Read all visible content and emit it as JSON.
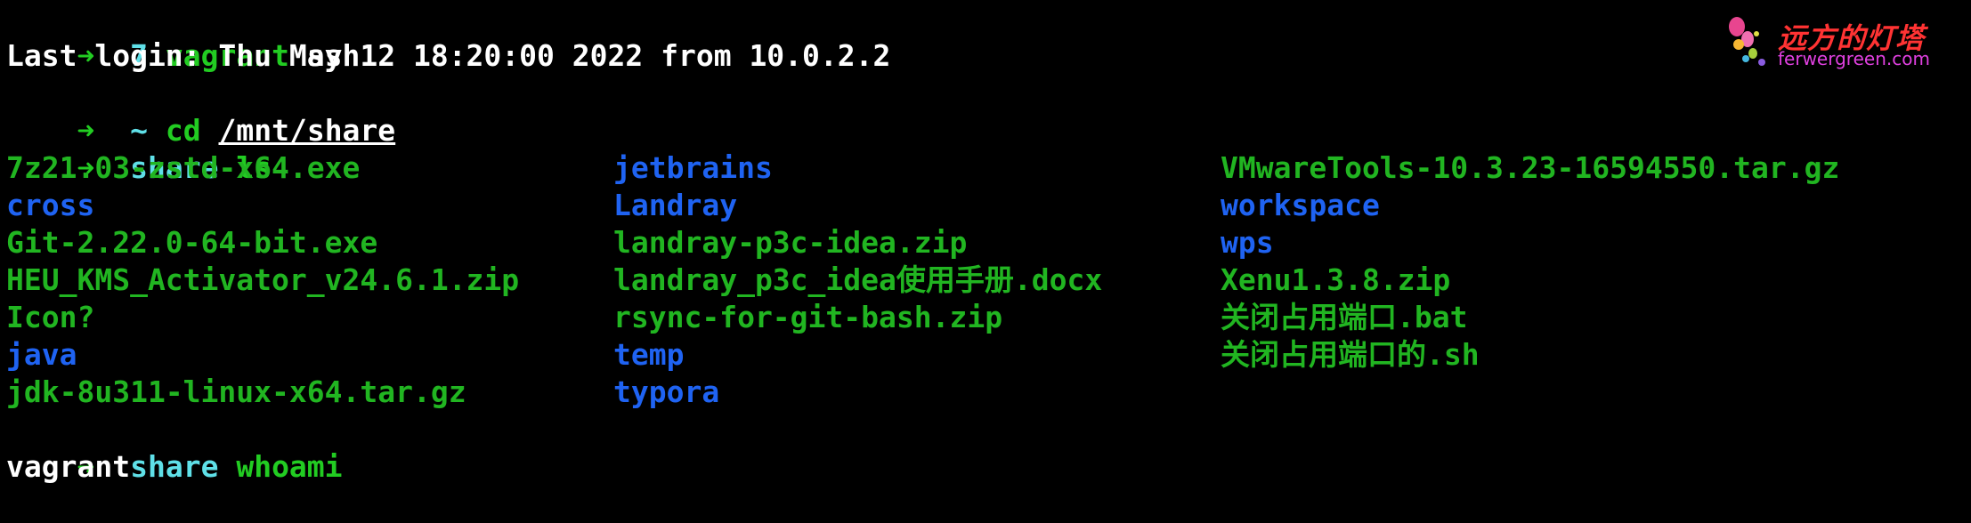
{
  "colors": {
    "background": "#000000",
    "prompt_arrow": "#22cc22",
    "prompt_dir": "#5fe0e8",
    "file": "#21b521",
    "directory": "#1f63f2",
    "output": "#ffffff"
  },
  "terminal": {
    "line1": {
      "arrow": "➜",
      "dir": "7",
      "command": "vagrant",
      "arg": "ssh"
    },
    "login_line": "Last login: Thu May 12 18:20:00 2022 from 10.0.2.2",
    "line3": {
      "arrow": "➜",
      "dir": "~",
      "command": "cd",
      "arg": "/mnt/share"
    },
    "line4": {
      "arrow": "➜",
      "dir": "share",
      "command": "ls"
    },
    "listing": {
      "col1": [
        {
          "name": "7z21.03-zstd-x64.exe",
          "type": "file"
        },
        {
          "name": "cross",
          "type": "dir"
        },
        {
          "name": "Git-2.22.0-64-bit.exe",
          "type": "file"
        },
        {
          "name": "HEU_KMS_Activator_v24.6.1.zip",
          "type": "file"
        },
        {
          "name": "Icon?",
          "type": "file"
        },
        {
          "name": "java",
          "type": "dir"
        },
        {
          "name": "jdk-8u311-linux-x64.tar.gz",
          "type": "file"
        }
      ],
      "col2": [
        {
          "name": "jetbrains",
          "type": "dir"
        },
        {
          "name": "Landray",
          "type": "dir"
        },
        {
          "name": "landray-p3c-idea.zip",
          "type": "file"
        },
        {
          "name": "landray_p3c_idea使用手册.docx",
          "type": "file"
        },
        {
          "name": "rsync-for-git-bash.zip",
          "type": "file"
        },
        {
          "name": "temp",
          "type": "dir"
        },
        {
          "name": "typora",
          "type": "dir"
        }
      ],
      "col3": [
        {
          "name": "VMwareTools-10.3.23-16594550.tar.gz",
          "type": "file"
        },
        {
          "name": "workspace",
          "type": "dir"
        },
        {
          "name": "wps",
          "type": "dir"
        },
        {
          "name": "Xenu1.3.8.zip",
          "type": "file"
        },
        {
          "name": "关闭占用端口.bat",
          "type": "file"
        },
        {
          "name": "关闭占用端口的.sh",
          "type": "file"
        }
      ]
    },
    "line_last": {
      "arrow": "➜",
      "dir": "share",
      "command": "whoami"
    },
    "whoami_output": "vagrant"
  },
  "watermark": {
    "chinese": "远方的灯塔",
    "domain": "ferwergreen.com"
  }
}
